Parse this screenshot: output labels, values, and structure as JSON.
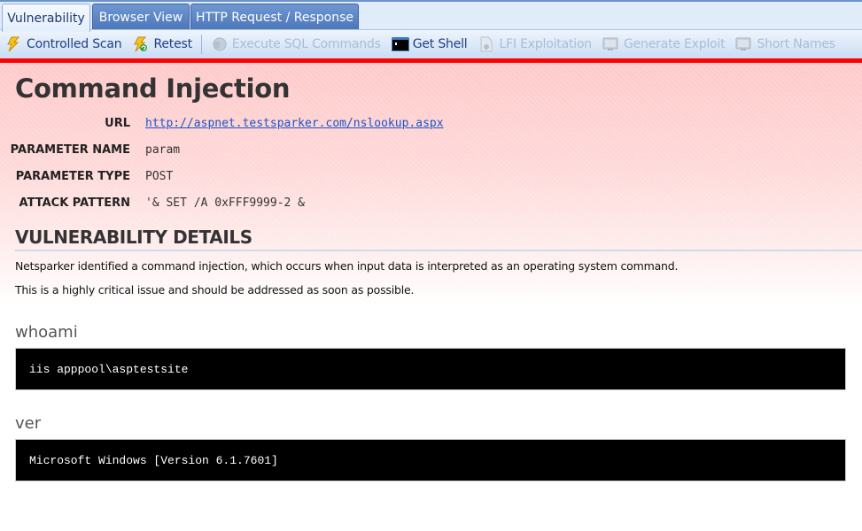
{
  "tabs": [
    {
      "label": "Vulnerability",
      "active": true
    },
    {
      "label": "Browser View",
      "active": false
    },
    {
      "label": "HTTP Request / Response",
      "active": false
    }
  ],
  "toolbar": {
    "controlled_scan": {
      "label": "Controlled Scan",
      "icon": "lightning-icon",
      "enabled": true
    },
    "retest": {
      "label": "Retest",
      "icon": "lightning-refresh-icon",
      "enabled": true
    },
    "execute_sql": {
      "label": "Execute SQL Commands",
      "icon": "database-icon",
      "enabled": false
    },
    "get_shell": {
      "label": "Get Shell",
      "icon": "terminal-icon",
      "enabled": true
    },
    "lfi": {
      "label": "LFI Exploitation",
      "icon": "file-code-icon",
      "enabled": false
    },
    "generate_exploit": {
      "label": "Generate Exploit",
      "icon": "monitor-icon",
      "enabled": false
    },
    "short_names": {
      "label": "Short Names",
      "icon": "monitor-icon",
      "enabled": false
    }
  },
  "colors": {
    "severity_bar": "#ff0000",
    "header_gradient_top": "#ffc9c9",
    "link": "#1a55c9",
    "toolbar_text": "#1e3f84"
  },
  "vulnerability": {
    "title": "Command Injection",
    "properties": [
      {
        "label": "URL",
        "value": "http://aspnet.testsparker.com/nslookup.aspx",
        "is_link": true
      },
      {
        "label": "PARAMETER NAME",
        "value": "param",
        "is_link": false
      },
      {
        "label": "PARAMETER TYPE",
        "value": "POST",
        "is_link": false
      },
      {
        "label": "ATTACK PATTERN",
        "value": "'& SET /A 0xFFF9999-2 &",
        "is_link": false
      }
    ]
  },
  "details": {
    "heading": "VULNERABILITY DETAILS",
    "paragraphs": [
      "Netsparker identified a command injection, which occurs when input data is interpreted as an operating system command.",
      "This is a highly critical issue and should be addressed as soon as possible."
    ]
  },
  "commands": [
    {
      "name": "whoami",
      "output": "iis apppool\\asptestsite"
    },
    {
      "name": "ver",
      "output": "Microsoft Windows [Version 6.1.7601]"
    }
  ]
}
